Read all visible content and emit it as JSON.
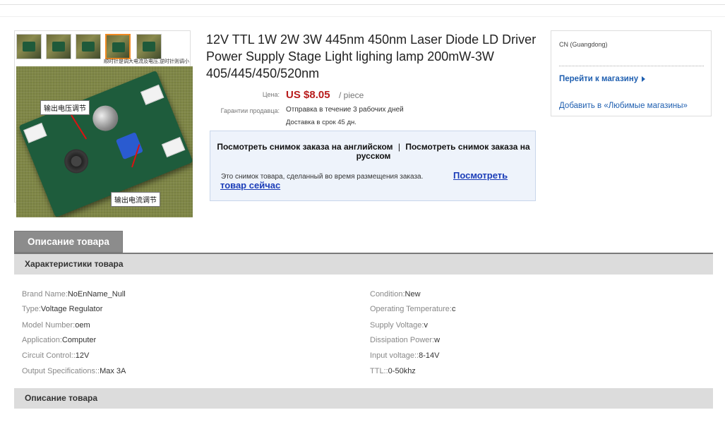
{
  "gallery": {
    "caption": "顺时针是调大电流及电压,逆时针则调小",
    "callouts": {
      "voltage": "输出电压调节",
      "current": "输出电流调节"
    }
  },
  "product": {
    "title": "12V TTL 1W 2W 3W 445nm 450nm Laser Diode LD Driver Power Supply Stage Light lighing lamp 200mW-3W 405/445/450/520nm",
    "price_label": "Цена:",
    "price": "US $8.05",
    "price_unit": "/ piece",
    "guarantee_label": "Гарантии продавца:",
    "shipping": "Отправка в течение 3 рабочих дней",
    "delivery": "Доставка в срок 45 дн."
  },
  "snapshot": {
    "title_en": "Посмотреть снимок заказа на английском",
    "title_sep": "|",
    "title_ru": "Посмотреть снимок заказа на русском",
    "text": "Это снимок товара, сделанный во время размещения заказа.",
    "link": "Посмотреть товар сейчас"
  },
  "store": {
    "location": "CN (Guangdong)",
    "goto": "Перейти к магазину",
    "favorite": "Добавить в «Любимые магазины»"
  },
  "tabs": {
    "description": "Описание товара"
  },
  "sections": {
    "specs": "Характеристики товара",
    "description": "Описание товара"
  },
  "specs": [
    {
      "key": "Brand Name:",
      "value": "NoEnName_Null"
    },
    {
      "key": "Condition:",
      "value": "New"
    },
    {
      "key": "Type:",
      "value": "Voltage Regulator"
    },
    {
      "key": "Operating Temperature:",
      "value": "c"
    },
    {
      "key": "Model Number:",
      "value": "oem"
    },
    {
      "key": "Supply Voltage:",
      "value": "v"
    },
    {
      "key": "Application:",
      "value": "Computer"
    },
    {
      "key": "Dissipation Power:",
      "value": "w"
    },
    {
      "key": "Circuit Control::",
      "value": "12V"
    },
    {
      "key": "Input voltage::",
      "value": "8-14V"
    },
    {
      "key": "Output Specifications::",
      "value": "Max 3A"
    },
    {
      "key": "TTL::",
      "value": "0-50khz"
    }
  ],
  "colors": {
    "price": "#b81c1c",
    "link": "#1f5fb0",
    "tab": "#8c8c8c",
    "section": "#dcdcdc"
  }
}
